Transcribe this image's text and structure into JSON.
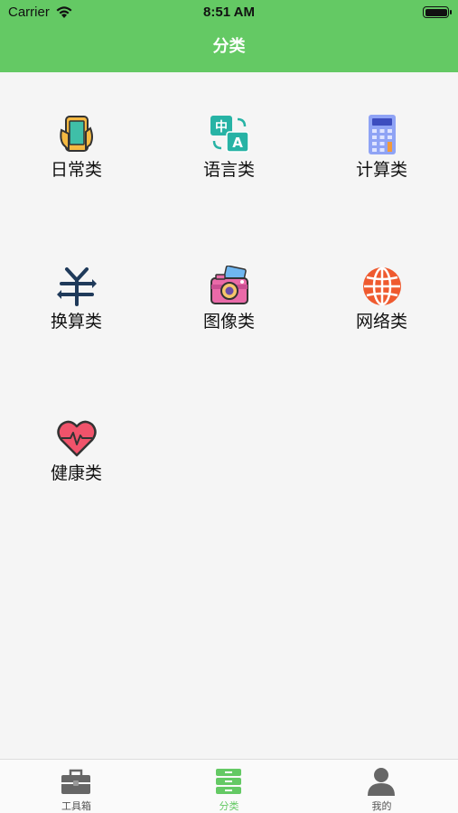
{
  "status_bar": {
    "carrier": "Carrier",
    "time": "8:51 AM"
  },
  "nav": {
    "title": "分类"
  },
  "categories": [
    {
      "label": "日常类",
      "icon": "phone-hand-icon"
    },
    {
      "label": "语言类",
      "icon": "translate-icon"
    },
    {
      "label": "计算类",
      "icon": "calculator-icon"
    },
    {
      "label": "换算类",
      "icon": "currency-exchange-icon"
    },
    {
      "label": "图像类",
      "icon": "camera-icon"
    },
    {
      "label": "网络类",
      "icon": "globe-icon"
    },
    {
      "label": "健康类",
      "icon": "heart-pulse-icon"
    }
  ],
  "tabbar": {
    "items": [
      {
        "label": "工具箱",
        "icon": "toolbox-icon"
      },
      {
        "label": "分类",
        "icon": "drawer-icon"
      },
      {
        "label": "我的",
        "icon": "user-icon"
      }
    ],
    "active_index": 1
  },
  "colors": {
    "accent": "#64c964",
    "background": "#f5f5f5",
    "inactive_tab": "#555555"
  }
}
